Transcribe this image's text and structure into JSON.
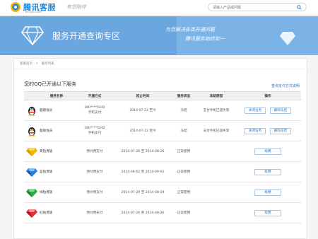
{
  "header": {
    "logo_text": "腾讯客服",
    "logo_sub": "KF.QQ.COM",
    "slogan": "有您陪伴",
    "search_placeholder": "请输入产品或问题"
  },
  "banner": {
    "title": "服务开通查询专区",
    "slogan_line1": "为您解决各类开通问题",
    "slogan_line2": "腾讯服务始终如一"
  },
  "breadcrumb": [
    "客服首页",
    ">",
    "服务列表"
  ],
  "main": {
    "section_title": "您的QQ已开通以下服务",
    "view_link": "查询支付方式说明",
    "columns": [
      "服务名称",
      "开通方式",
      "起止时间",
      "服务状态",
      "冻结原因",
      "操作"
    ],
    "rows": [
      {
        "icon": "qq-penguin-icon",
        "name": "超级会员",
        "method1": "180****5242",
        "method2": "手机支付",
        "time": "2014-07-22 至今",
        "status": "冻结",
        "reason": "支付手机已遗失等",
        "actions": [
          "关闭业务",
          "解除冻结"
        ]
      },
      {
        "icon": "qq-penguin-icon",
        "name": "超级会员",
        "method1": "180****5242",
        "method2": "手机支付",
        "time": "2014-07-22 至今",
        "status": "冻结",
        "reason": "支付手机已遗失等",
        "actions": [
          "关闭业务",
          "解除冻结"
        ]
      },
      {
        "icon": "yellow-diamond-icon",
        "name": "黄钻贵族",
        "method1": "预付费支付",
        "method2": "",
        "time": "2014-07-26 至 2014-08-26",
        "status": "正常使用",
        "reason": "",
        "actions": [
          "续费"
        ]
      },
      {
        "icon": "blue-diamond-icon",
        "name": "蓝钻贵族",
        "method1": "预付费支付",
        "method2": "",
        "time": "2014-08-02 至 2014-09-02",
        "status": "正常使用",
        "reason": "",
        "actions": [
          "续费"
        ]
      },
      {
        "icon": "green-diamond-icon",
        "name": "绿钻贵族",
        "method1": "预付费支付",
        "method2": "",
        "time": "2014-07-29 至 2014-08-29",
        "status": "正常使用",
        "reason": "",
        "actions": [
          "续费"
        ]
      },
      {
        "icon": "red-diamond-icon",
        "name": "红钻贵族",
        "method1": "预付费支付",
        "method2": "",
        "time": "2014-07-26 至 2014-08-26",
        "status": "正常使用",
        "reason": "",
        "actions": [
          "续费"
        ]
      }
    ]
  },
  "colors": {
    "accent": "#2a73c4",
    "banner": "#6aa6e0",
    "logo": "#1f86d8"
  }
}
